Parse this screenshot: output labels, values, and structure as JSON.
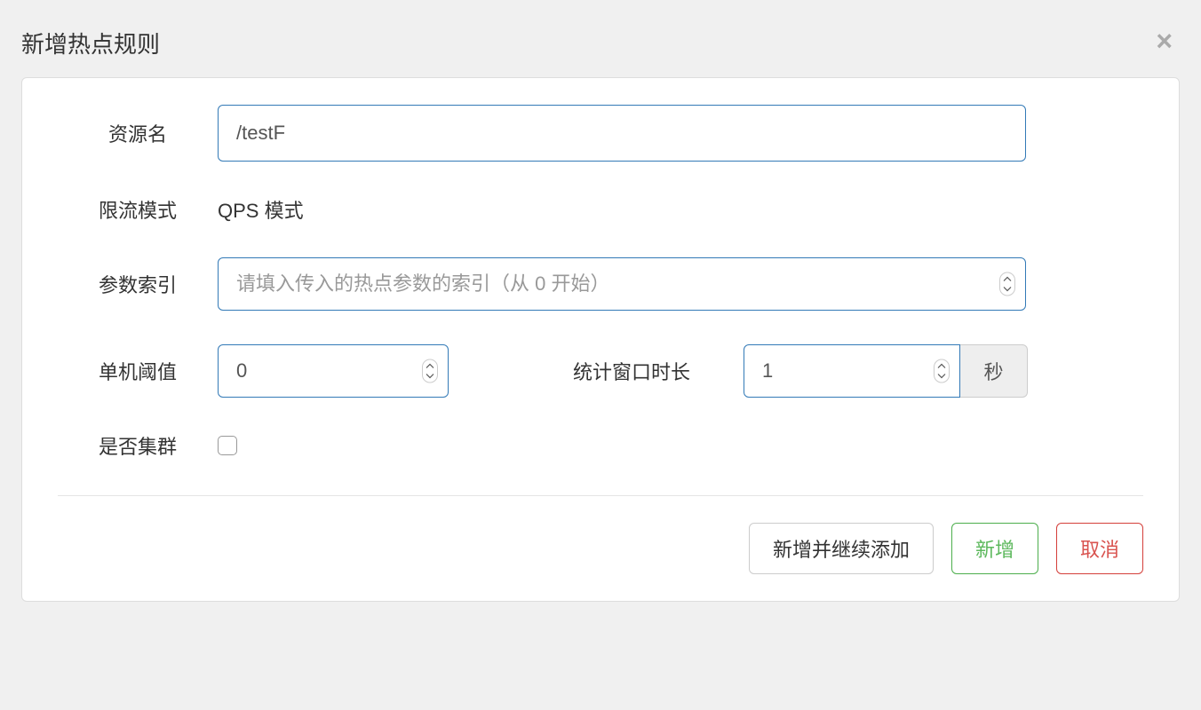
{
  "modal": {
    "title": "新增热点规则",
    "close": "×"
  },
  "form": {
    "resource_label": "资源名",
    "resource_value": "/testF",
    "mode_label": "限流模式",
    "mode_value": "QPS 模式",
    "param_index_label": "参数索引",
    "param_index_placeholder": "请填入传入的热点参数的索引（从 0 开始）",
    "threshold_label": "单机阈值",
    "threshold_value": "0",
    "window_label": "统计窗口时长",
    "window_value": "1",
    "window_unit": "秒",
    "cluster_label": "是否集群"
  },
  "footer": {
    "add_continue": "新增并继续添加",
    "add": "新增",
    "cancel": "取消"
  }
}
